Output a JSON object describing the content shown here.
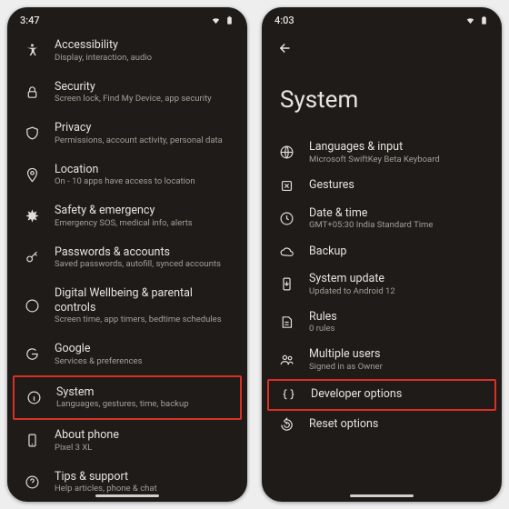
{
  "left": {
    "time": "3:47",
    "items": [
      {
        "title": "Accessibility",
        "sub": "Display, interaction, audio"
      },
      {
        "title": "Security",
        "sub": "Screen lock, Find My Device, app security"
      },
      {
        "title": "Privacy",
        "sub": "Permissions, account activity, personal data"
      },
      {
        "title": "Location",
        "sub": "On - 10 apps have access to location"
      },
      {
        "title": "Safety & emergency",
        "sub": "Emergency SOS, medical info, alerts"
      },
      {
        "title": "Passwords & accounts",
        "sub": "Saved passwords, autofill, synced accounts"
      },
      {
        "title": "Digital Wellbeing & parental controls",
        "sub": "Screen time, app timers, bedtime schedules"
      },
      {
        "title": "Google",
        "sub": "Services & preferences"
      },
      {
        "title": "System",
        "sub": "Languages, gestures, time, backup"
      },
      {
        "title": "About phone",
        "sub": "Pixel 3 XL"
      },
      {
        "title": "Tips & support",
        "sub": "Help articles, phone & chat"
      }
    ]
  },
  "right": {
    "time": "4:03",
    "page_title": "System",
    "items": [
      {
        "title": "Languages & input",
        "sub": "Microsoft SwiftKey Beta Keyboard"
      },
      {
        "title": "Gestures",
        "sub": ""
      },
      {
        "title": "Date & time",
        "sub": "GMT+05:30 India Standard Time"
      },
      {
        "title": "Backup",
        "sub": ""
      },
      {
        "title": "System update",
        "sub": "Updated to Android 12"
      },
      {
        "title": "Rules",
        "sub": "0 rules"
      },
      {
        "title": "Multiple users",
        "sub": "Signed in as Owner"
      },
      {
        "title": "Developer options",
        "sub": ""
      },
      {
        "title": "Reset options",
        "sub": ""
      }
    ]
  }
}
